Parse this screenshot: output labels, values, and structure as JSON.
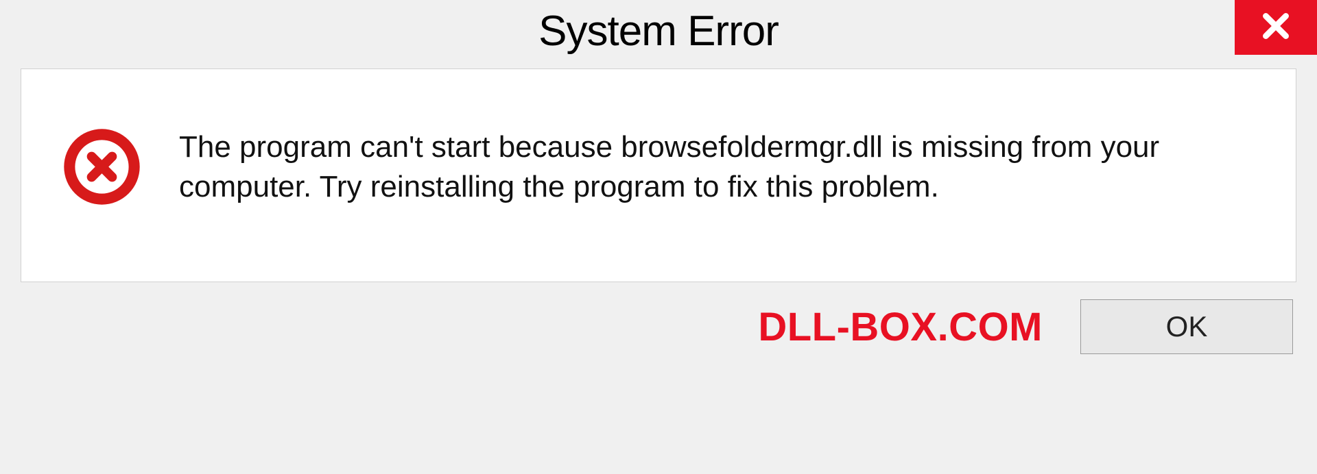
{
  "dialog": {
    "title": "System Error",
    "message": "The program can't start because browsefoldermgr.dll is missing from your computer. Try reinstalling the program to fix this problem.",
    "ok_label": "OK",
    "watermark": "DLL-BOX.COM"
  },
  "colors": {
    "accent_red": "#e81123"
  }
}
